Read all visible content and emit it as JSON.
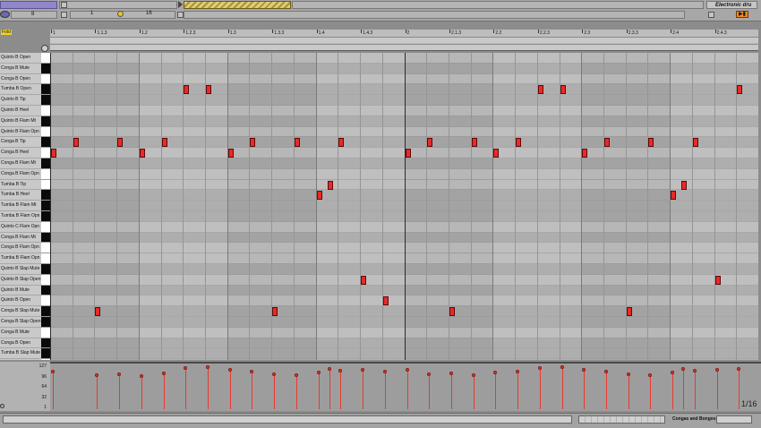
{
  "top": {
    "left_number": "8",
    "position_start": "1",
    "position_end": "16",
    "clip_title": "Electronic dru"
  },
  "editor": {
    "fold_label": "Fold",
    "ruler_labels": [
      "1",
      "1.1.3",
      "1.2",
      "1.2.3",
      "1.3",
      "1.3.3",
      "1.4",
      "1.4.3",
      "2",
      "2.1.3",
      "2.2",
      "2.2.3",
      "2.3",
      "2.3.3",
      "2.4",
      "2.4.3"
    ],
    "drum_rows": [
      "Quinto B Open",
      "Conga B Mute",
      "Conga B Open",
      "Tumba B Open",
      "Quinto B Tip",
      "Quinto B Heel",
      "Quinto B Flam Mt",
      "Quinto B Flam Opn",
      "Conga B Tip",
      "Conga B Heel",
      "Conga B Flam Mt",
      "Conga B Flam Opn",
      "Tumba B Tip",
      "Tumba B Heel",
      "Tumba B Flam Mt",
      "Tumba B Flam Opn",
      "Quinto C Flam Opn",
      "Conga B Flam Mt",
      "Conga B Flam Opn",
      "Tumba B Flam Opn",
      "Quinto B Slap Mute",
      "Quinto B Slap Open",
      "Quinto B Mute",
      "Quinto B Open",
      "Conga B Slap Mute",
      "Conga B Slap Open",
      "Conga B Mute",
      "Conga B Open",
      "Tumba B Slap Mute"
    ],
    "black_key_rows": [
      1,
      3,
      4,
      6,
      8,
      10,
      13,
      14,
      15,
      17,
      20,
      22,
      24,
      25,
      27,
      28
    ],
    "notes": [
      {
        "row": 3,
        "step": 6
      },
      {
        "row": 3,
        "step": 7
      },
      {
        "row": 3,
        "step": 22
      },
      {
        "row": 3,
        "step": 23
      },
      {
        "row": 3,
        "step": 31
      },
      {
        "row": 8,
        "step": 1
      },
      {
        "row": 8,
        "step": 3
      },
      {
        "row": 8,
        "step": 5
      },
      {
        "row": 8,
        "step": 9
      },
      {
        "row": 8,
        "step": 11
      },
      {
        "row": 8,
        "step": 13
      },
      {
        "row": 8,
        "step": 17
      },
      {
        "row": 8,
        "step": 19
      },
      {
        "row": 8,
        "step": 21
      },
      {
        "row": 8,
        "step": 25
      },
      {
        "row": 8,
        "step": 27
      },
      {
        "row": 8,
        "step": 29
      },
      {
        "row": 9,
        "step": 0
      },
      {
        "row": 9,
        "step": 4
      },
      {
        "row": 9,
        "step": 8
      },
      {
        "row": 9,
        "step": 16
      },
      {
        "row": 9,
        "step": 20
      },
      {
        "row": 9,
        "step": 24
      },
      {
        "row": 12,
        "step": 12.5
      },
      {
        "row": 12,
        "step": 28.5
      },
      {
        "row": 13,
        "step": 12
      },
      {
        "row": 13,
        "step": 28
      },
      {
        "row": 21,
        "step": 14
      },
      {
        "row": 21,
        "step": 30
      },
      {
        "row": 23,
        "step": 15
      },
      {
        "row": 24,
        "step": 2
      },
      {
        "row": 24,
        "step": 10
      },
      {
        "row": 24,
        "step": 18
      },
      {
        "row": 24,
        "step": 26
      }
    ],
    "total_steps": 32
  },
  "velocity": {
    "scale_labels": [
      "127",
      "96",
      "64",
      "32",
      "1"
    ],
    "quantize": "1/16",
    "stems": [
      {
        "step": 0,
        "vel": 112
      },
      {
        "step": 2,
        "vel": 100
      },
      {
        "step": 3,
        "vel": 104
      },
      {
        "step": 4,
        "vel": 98
      },
      {
        "step": 5,
        "vel": 106
      },
      {
        "step": 6,
        "vel": 122
      },
      {
        "step": 7,
        "vel": 124
      },
      {
        "step": 8,
        "vel": 116
      },
      {
        "step": 9,
        "vel": 110
      },
      {
        "step": 10,
        "vel": 104
      },
      {
        "step": 11,
        "vel": 100
      },
      {
        "step": 12,
        "vel": 108
      },
      {
        "step": 12.5,
        "vel": 118
      },
      {
        "step": 13,
        "vel": 115
      },
      {
        "step": 14,
        "vel": 116
      },
      {
        "step": 15,
        "vel": 110
      },
      {
        "step": 16,
        "vel": 117
      },
      {
        "step": 17,
        "vel": 102
      },
      {
        "step": 18,
        "vel": 106
      },
      {
        "step": 19,
        "vel": 100
      },
      {
        "step": 20,
        "vel": 108
      },
      {
        "step": 21,
        "vel": 112
      },
      {
        "step": 22,
        "vel": 122
      },
      {
        "step": 23,
        "vel": 124
      },
      {
        "step": 24,
        "vel": 116
      },
      {
        "step": 25,
        "vel": 110
      },
      {
        "step": 26,
        "vel": 104
      },
      {
        "step": 27,
        "vel": 100
      },
      {
        "step": 28,
        "vel": 108
      },
      {
        "step": 28.5,
        "vel": 118
      },
      {
        "step": 29,
        "vel": 115
      },
      {
        "step": 30,
        "vel": 116
      },
      {
        "step": 31,
        "vel": 120
      }
    ]
  },
  "status": {
    "track_name": "Congas and Bongos"
  },
  "colors": {
    "note": "#e82a28",
    "accent_orange": "#f08a20",
    "clip_purple": "#8f86cc",
    "fold_yellow": "#f0d030"
  }
}
